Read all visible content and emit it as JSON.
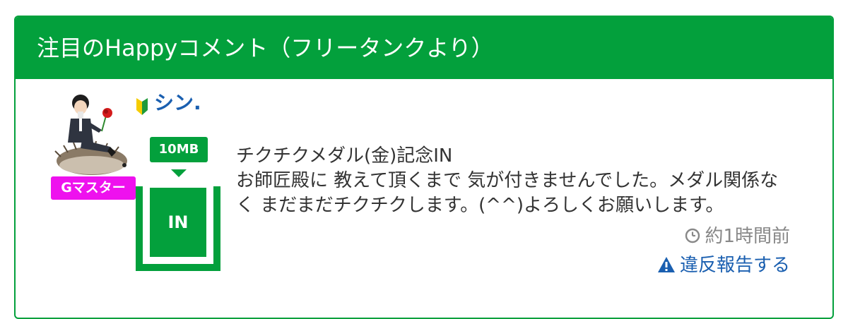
{
  "panel": {
    "title": "注目のHappyコメント（フリータンクより）"
  },
  "comment": {
    "user": {
      "name": "シン.",
      "rank_badge": "Gマスター",
      "beginner_mark_icon": "beginner-leaf-icon",
      "avatar": "avatar-man-on-hedgehog-with-rose"
    },
    "tank": {
      "amount": "10MB",
      "action": "IN",
      "fill_level": 1.0
    },
    "text": {
      "line1": "チクチクメダル(金)記念IN",
      "line2": "お師匠殿に 教えて頂くまで 気が付きませんでした。メダル関係なく まだまだチクチクします。(^^)よろしくお願いします。"
    },
    "timestamp": "約1時間前",
    "report_link": "違反報告する"
  },
  "colors": {
    "accent": "#03a03c",
    "link": "#1a5fb0",
    "badge_magenta": "#ee11ee",
    "muted": "#888888"
  }
}
